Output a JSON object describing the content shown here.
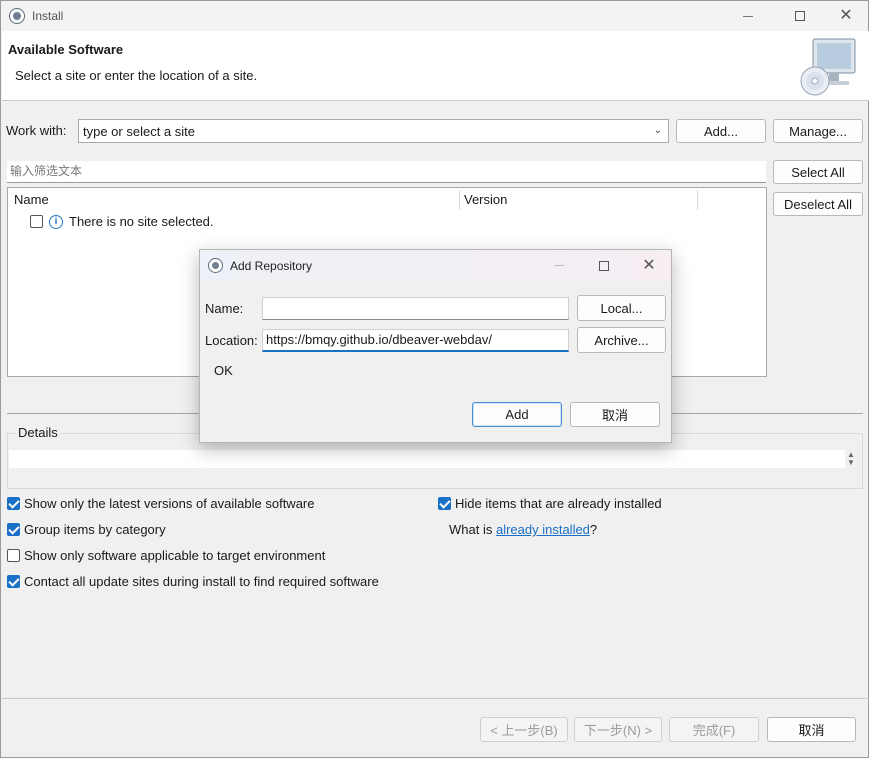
{
  "window": {
    "title": "Install"
  },
  "header": {
    "title": "Available Software",
    "subtitle": "Select a site or enter the location of a site."
  },
  "work_with": {
    "label": "Work with:",
    "value": "type or select a site",
    "add_label": "Add...",
    "manage_label": "Manage..."
  },
  "filter": {
    "placeholder": "输入筛选文本"
  },
  "selection": {
    "select_all_label": "Select All",
    "deselect_all_label": "Deselect All"
  },
  "table": {
    "columns": [
      "Name",
      "Version"
    ],
    "rows": [
      {
        "name": "There is no site selected.",
        "checked": false
      }
    ]
  },
  "details": {
    "legend": "Details"
  },
  "options": {
    "latest_versions": {
      "label": "Show only the latest versions of available software",
      "checked": true
    },
    "group_by_category": {
      "label": "Group items by category",
      "checked": true
    },
    "applicable_only": {
      "label": "Show only software applicable to target environment",
      "checked": false
    },
    "contact_all_sites": {
      "label": "Contact all update sites during install to find required software",
      "checked": true
    },
    "hide_installed": {
      "label": "Hide items that are already installed",
      "checked": true
    },
    "what_is_prefix": "What is ",
    "what_is_link": "already installed",
    "what_is_suffix": "?"
  },
  "footer": {
    "back_label": "< 上一步(B)",
    "next_label": "下一步(N) >",
    "finish_label": "完成(F)",
    "cancel_label": "取消"
  },
  "dialog": {
    "title": "Add Repository",
    "name_label": "Name:",
    "name_value": "",
    "local_label": "Local...",
    "location_label": "Location:",
    "location_value": "https://bmqy.github.io/dbeaver-webdav/",
    "archive_label": "Archive...",
    "status_text": "OK",
    "add_label": "Add",
    "cancel_label": "取消"
  },
  "colors": {
    "accent": "#1a6fc7",
    "window_bg": "#f0f0f0"
  }
}
